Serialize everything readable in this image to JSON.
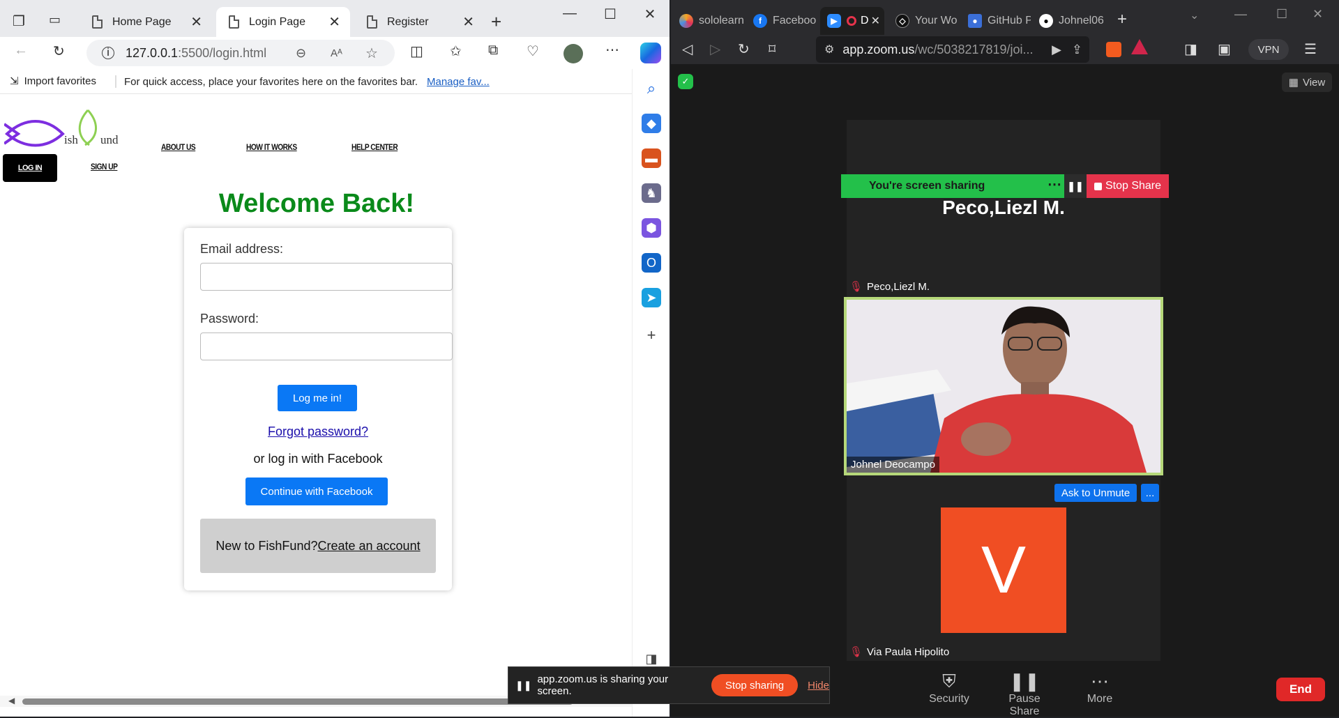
{
  "edge": {
    "tabs": [
      {
        "label": "Home Page"
      },
      {
        "label": "Login Page"
      },
      {
        "label": "Register"
      }
    ],
    "address": {
      "host": "127.0.0.1",
      "rest": ":5500/login.html"
    },
    "favorites_bar": {
      "import_label": "Import favorites",
      "hint": "For quick access, place your favorites here on the favorites bar.",
      "manage_link": "Manage fav..."
    }
  },
  "site": {
    "logo_text_1": "ish",
    "logo_text_2": "und",
    "nav": {
      "about": "ABOUT US",
      "how": "HOW IT WORKS",
      "help": "HELP CENTER",
      "login": "LOG IN",
      "signup": "SIGN UP"
    },
    "welcome": "Welcome Back!",
    "form": {
      "email_label": "Email address:",
      "password_label": "Password:",
      "submit": "Log me in!",
      "forgot": "Forgot password?",
      "facebook_hint": "or log in with Facebook",
      "facebook_button": "Continue with Facebook",
      "new_prefix": "New to FishFund?",
      "create_link": "Create an account"
    }
  },
  "brave": {
    "tabs": [
      "sololearn",
      "Faceboo",
      "D",
      "Your Wo",
      "GitHub P",
      "Johnel06"
    ],
    "url_host": "app.zoom.us",
    "url_rest": "/wc/5038217819/joi...",
    "vpn": "VPN"
  },
  "zoom": {
    "view_label": "View",
    "sharing_banner": "You're screen sharing",
    "stop_share": "Stop Share",
    "presenter_name": "Peco,Liezl M.",
    "participants": [
      {
        "name": "Peco,Liezl M."
      },
      {
        "name": "Johnel Deocampo"
      },
      {
        "name": "Via Paula Hipolito",
        "initial": "V"
      }
    ],
    "ask_unmute": "Ask to Unmute",
    "more_dots": "...",
    "toolbar": {
      "security": "Security",
      "pause": "Pause Share",
      "more": "More",
      "end": "End"
    },
    "share_notice": {
      "text": "app.zoom.us is sharing your screen.",
      "stop": "Stop sharing",
      "hide": "Hide"
    }
  },
  "colors": {
    "welcome": "#0a8a1a",
    "zoom_blue": "#0e72ed",
    "share_green": "#23c04a",
    "stop_red": "#e5334b",
    "avatar_orange": "#f04e23"
  }
}
